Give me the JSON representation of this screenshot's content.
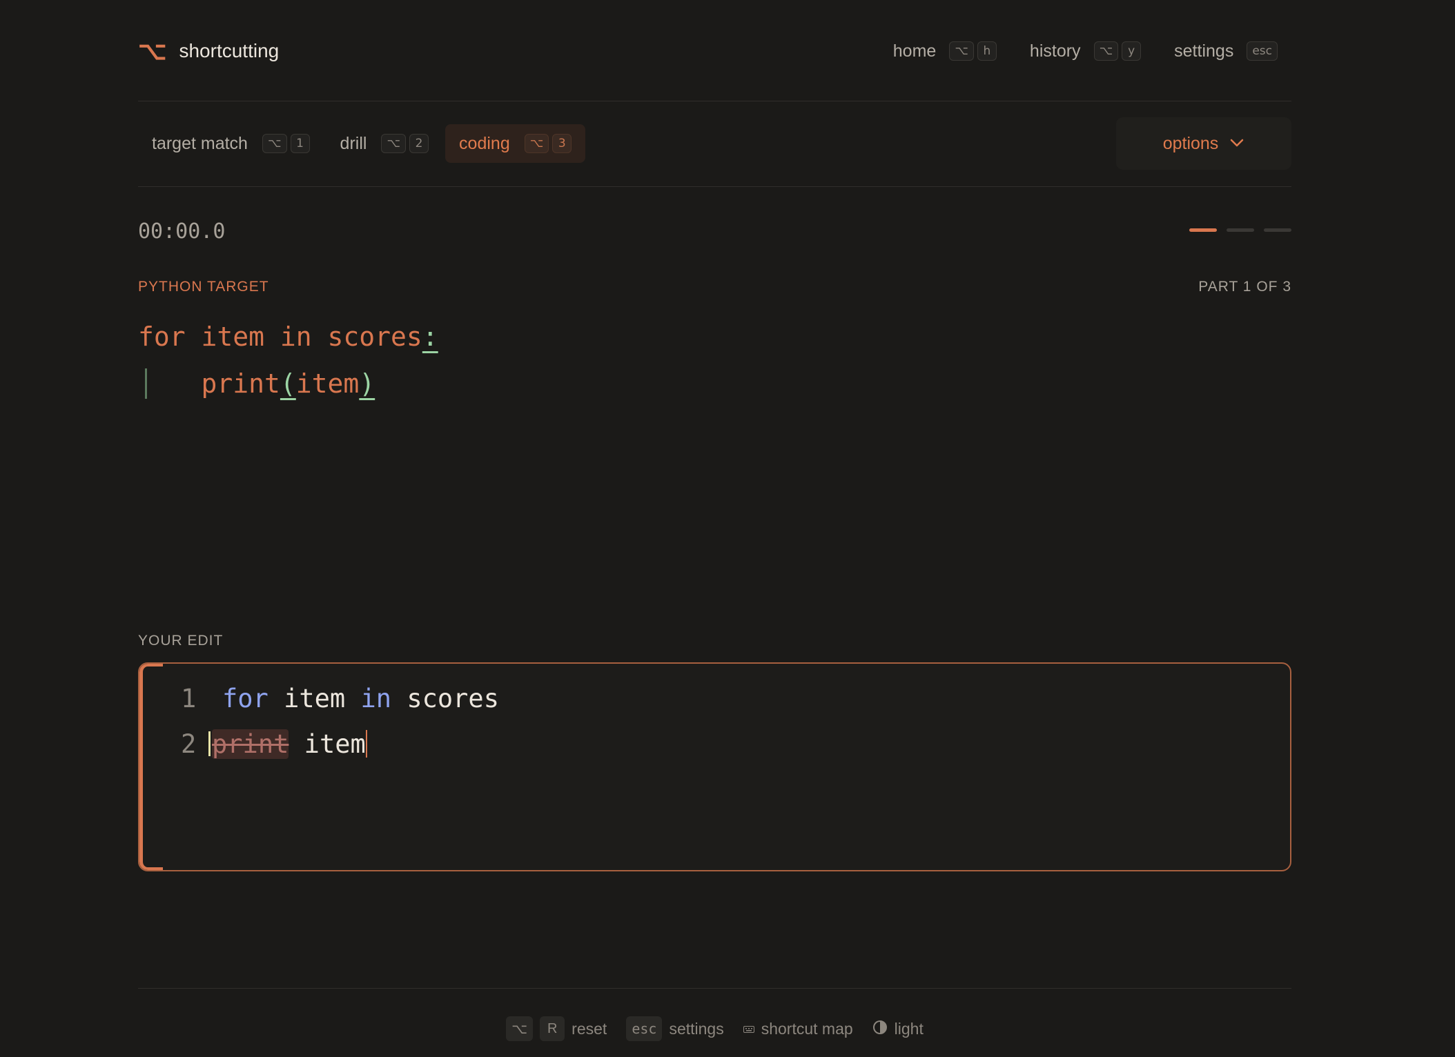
{
  "header": {
    "brand_icon": "⌥",
    "brand_name": "shortcutting",
    "nav": [
      {
        "label": "home",
        "keys": [
          "⌥",
          "h"
        ]
      },
      {
        "label": "history",
        "keys": [
          "⌥",
          "y"
        ]
      },
      {
        "label": "settings",
        "keys": [
          "esc"
        ]
      }
    ]
  },
  "tabs": [
    {
      "label": "target match",
      "keys": [
        "⌥",
        "1"
      ],
      "active": false
    },
    {
      "label": "drill",
      "keys": [
        "⌥",
        "2"
      ],
      "active": false
    },
    {
      "label": "coding",
      "keys": [
        "⌥",
        "3"
      ],
      "active": true
    }
  ],
  "options": {
    "label": "options",
    "icon": "chevron-down-icon"
  },
  "timer": "00:00.0",
  "progress": {
    "current": 1,
    "total": 3
  },
  "target": {
    "label": "PYTHON TARGET",
    "part": "PART 1 OF 3",
    "lines": [
      {
        "parts": [
          {
            "text": "for item in scores",
            "mark": false
          },
          {
            "text": ":",
            "mark": true
          }
        ]
      },
      {
        "parts": [
          {
            "text": "    print",
            "mark": false
          },
          {
            "text": "(",
            "mark": true
          },
          {
            "text": "item",
            "mark": false
          },
          {
            "text": ")",
            "mark": true
          }
        ]
      }
    ]
  },
  "edit": {
    "label": "YOUR EDIT",
    "lines": [
      {
        "num": "1",
        "tokens": [
          {
            "text": "for",
            "kind": "kw"
          },
          {
            "text": " item ",
            "kind": "plain"
          },
          {
            "text": "in",
            "kind": "kw"
          },
          {
            "text": " scores",
            "kind": "plain"
          }
        ]
      },
      {
        "num": "2",
        "tokens": [
          {
            "text": "print",
            "kind": "del"
          },
          {
            "text": " item",
            "kind": "plain"
          }
        ]
      }
    ]
  },
  "footer": {
    "reset": {
      "keys": [
        "⌥",
        "R"
      ],
      "label": "reset"
    },
    "settings": {
      "key": "esc",
      "label": "settings"
    },
    "shortcut_map": {
      "icon": "keyboard-icon",
      "label": "shortcut map"
    },
    "theme": {
      "icon": "half-circle-icon",
      "label": "light"
    }
  },
  "colors": {
    "accent": "#d9774f",
    "background": "#1b1a18",
    "keyword": "#8fa3ee",
    "match": "#9cd4a4"
  }
}
